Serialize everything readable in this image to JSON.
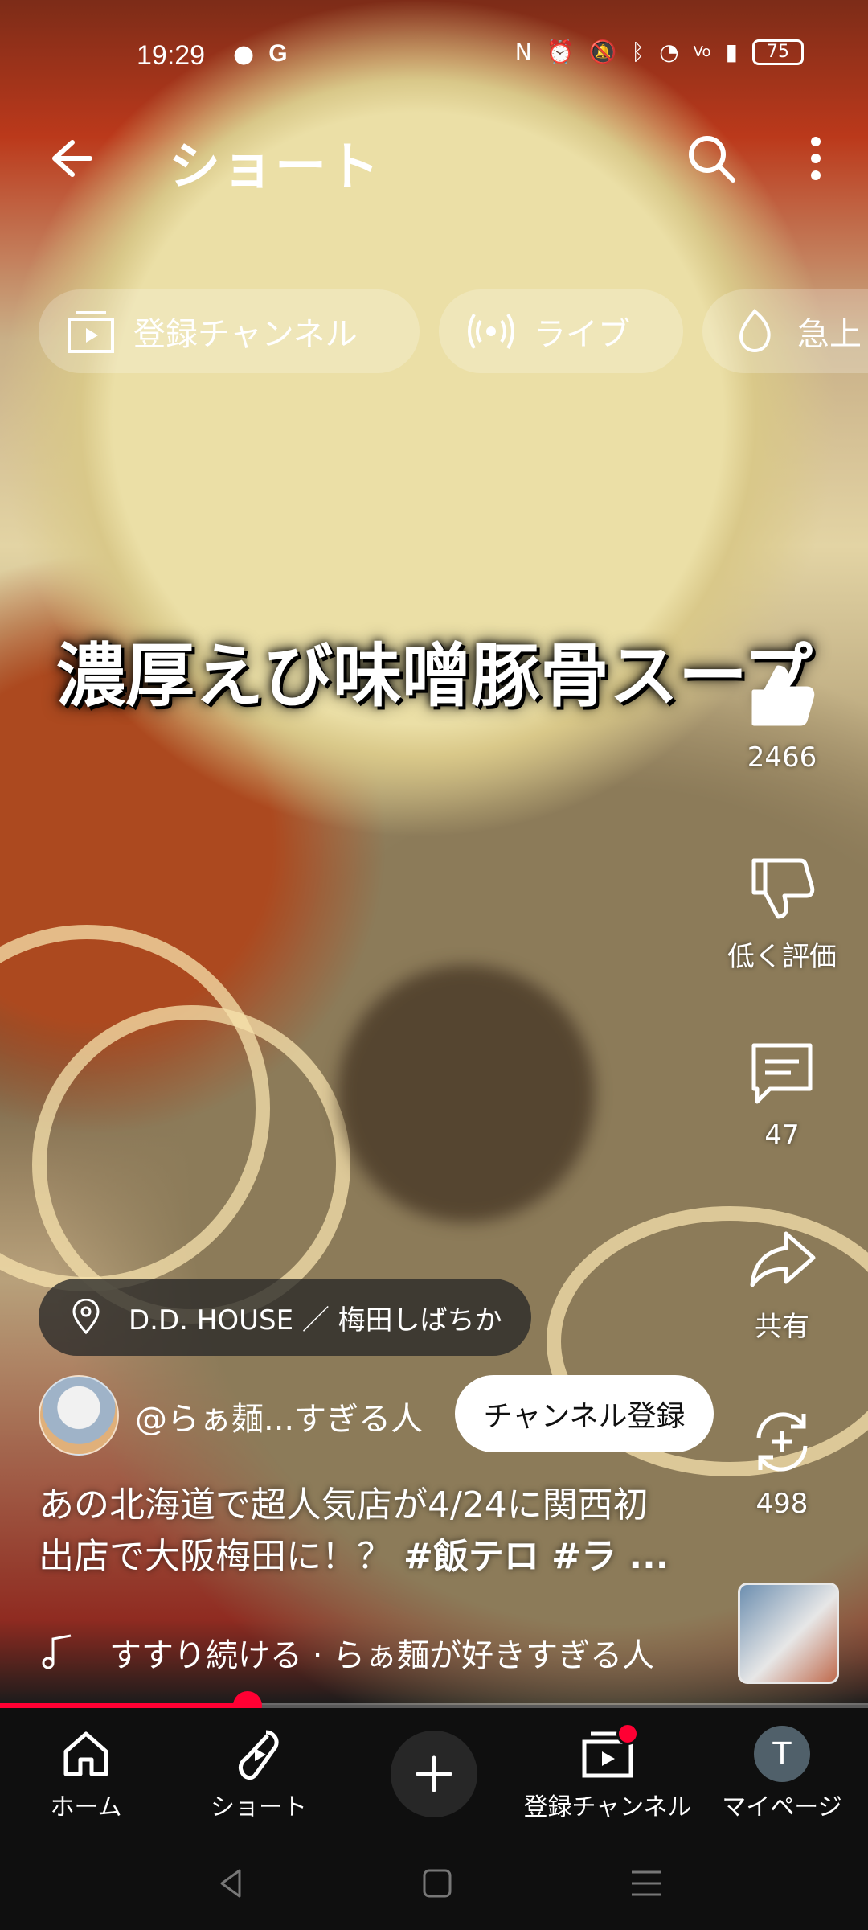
{
  "status_bar": {
    "time": "19:29",
    "battery": "75",
    "left_icons": [
      "line-icon",
      "google-icon"
    ],
    "right_icons": [
      "nfc-icon",
      "alarm-icon",
      "mute-icon",
      "bluetooth-icon",
      "wifi-icon",
      "volte-icon",
      "signal-icon",
      "battery-icon"
    ]
  },
  "top_bar": {
    "title": "ショート"
  },
  "chips": [
    {
      "label": "登録チャンネル",
      "icon": "subscriptions-icon"
    },
    {
      "label": "ライブ",
      "icon": "live-icon"
    },
    {
      "label": "急上",
      "icon": "trending-icon"
    }
  ],
  "video": {
    "overlay_caption": "濃厚えび味噌豚骨スープ",
    "progress": 0.285
  },
  "actions": {
    "like_count": "2466",
    "dislike_label": "低く評価",
    "comment_count": "47",
    "share_label": "共有",
    "remix_count": "498"
  },
  "location": {
    "label": "D.D. HOUSE ／ 梅田しばちか"
  },
  "channel": {
    "name": "@らぁ麺...すぎる人",
    "subscribe_label": "チャンネル登録"
  },
  "description": {
    "line1": "あの北海道で超人気店が4/24に関西初",
    "line2_prefix": "出店で大阪梅田に！？ ",
    "line2_tags": "#飯テロ #ラ ..."
  },
  "music": {
    "label": "すすり続ける · らぁ麺が好きすぎる人"
  },
  "bottom_nav": {
    "home": "ホーム",
    "shorts": "ショート",
    "subscriptions": "登録チャンネル",
    "mypage": "マイページ",
    "avatar_initial": "T"
  },
  "colors": {
    "accent": "#ff0033",
    "nav_bg": "#0f0f0f"
  }
}
